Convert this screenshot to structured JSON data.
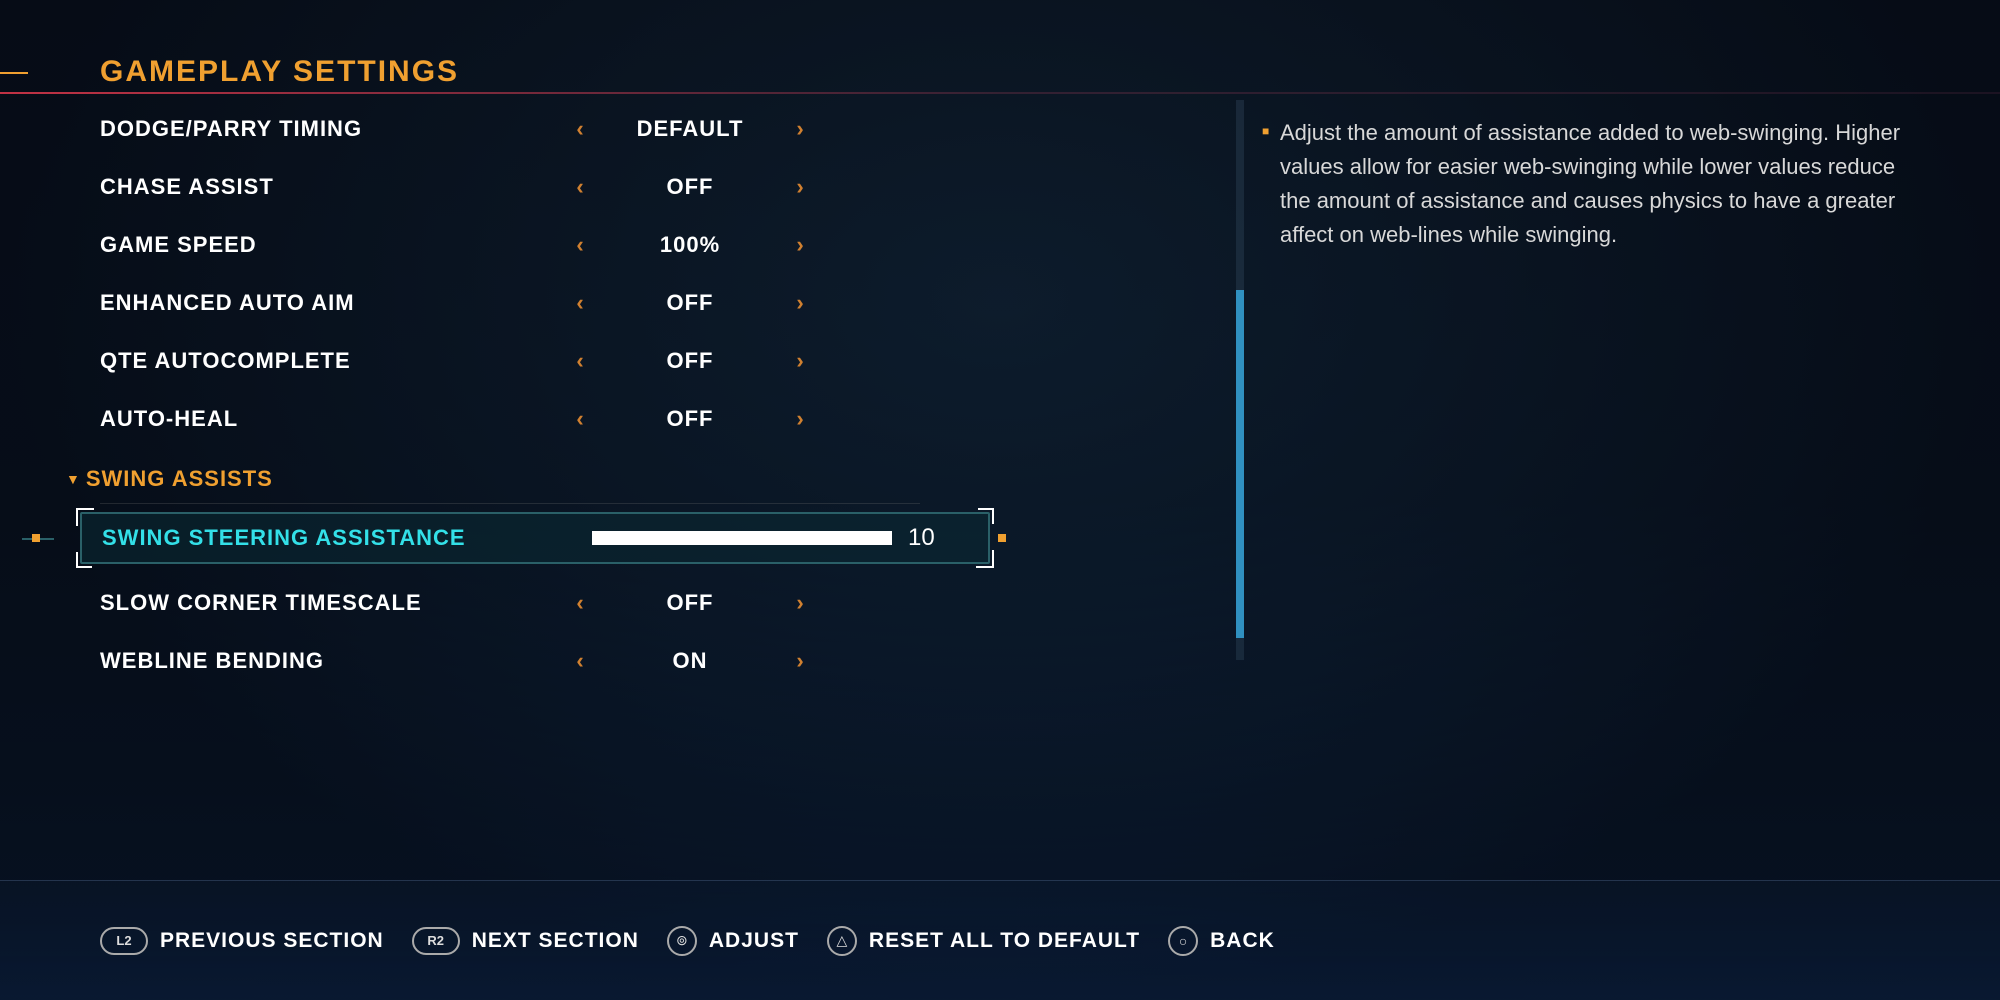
{
  "title": "GAMEPLAY SETTINGS",
  "options": [
    {
      "label": "DODGE/PARRY TIMING",
      "value": "DEFAULT"
    },
    {
      "label": "CHASE ASSIST",
      "value": "OFF"
    },
    {
      "label": "GAME SPEED",
      "value": "100%"
    },
    {
      "label": "ENHANCED AUTO AIM",
      "value": "OFF"
    },
    {
      "label": "QTE AUTOCOMPLETE",
      "value": "OFF"
    },
    {
      "label": "AUTO-HEAL",
      "value": "OFF"
    }
  ],
  "category": {
    "label": "SWING ASSISTS"
  },
  "selected": {
    "label": "SWING STEERING ASSISTANCE",
    "value": "10"
  },
  "post_options": [
    {
      "label": "SLOW CORNER TIMESCALE",
      "value": "OFF"
    },
    {
      "label": "WEBLINE BENDING",
      "value": "ON"
    }
  ],
  "description": "Adjust the amount of assistance added to web-swinging. Higher values allow for easier web-swinging while lower values reduce the amount of assistance and causes physics to have a greater affect on web-lines while swinging.",
  "footer": {
    "prev": {
      "glyph": "L2",
      "label": "PREVIOUS SECTION"
    },
    "next": {
      "glyph": "R2",
      "label": "NEXT SECTION"
    },
    "adjust": {
      "label": "ADJUST"
    },
    "reset": {
      "glyph": "△",
      "label": "RESET ALL TO DEFAULT"
    },
    "back": {
      "glyph": "○",
      "label": "BACK"
    }
  },
  "scrollbar": {
    "thumb_top_pct": 34,
    "thumb_height_pct": 62
  }
}
